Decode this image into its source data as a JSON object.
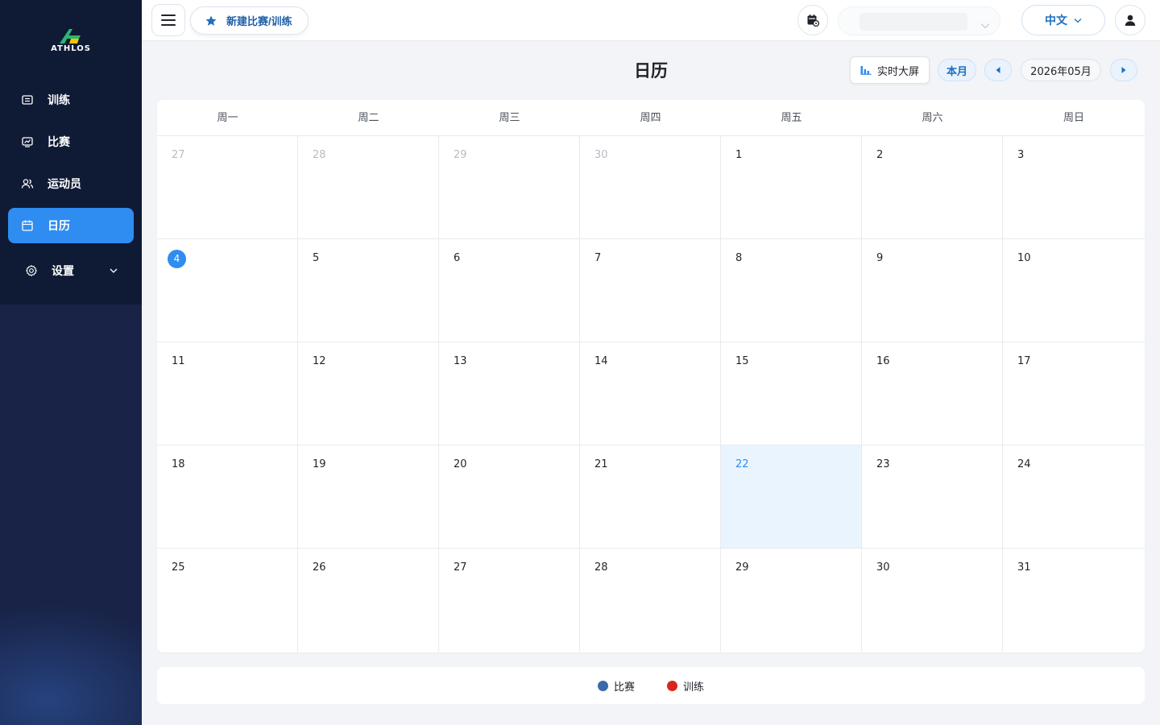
{
  "brand": {
    "logo_text": "ATHLOS"
  },
  "colors": {
    "accent": "#2f8cf0",
    "sidebar": "#182347",
    "match": "#3a6aa8",
    "training": "#d9261c"
  },
  "sidebar": {
    "items": [
      {
        "label": "训练",
        "icon": "training-icon"
      },
      {
        "label": "比赛",
        "icon": "match-icon"
      },
      {
        "label": "运动员",
        "icon": "athletes-icon"
      },
      {
        "label": "日历",
        "icon": "calendar-icon",
        "active": true
      },
      {
        "label": "设置",
        "icon": "gear-icon"
      }
    ]
  },
  "topbar": {
    "new_button": "新建比赛/训练",
    "language": "中文"
  },
  "calendar": {
    "title": "日历",
    "live_button": "实时大屏",
    "this_month_button": "本月",
    "current_month": "2026年05月",
    "weekdays": [
      "周一",
      "周二",
      "周三",
      "周四",
      "周五",
      "周六",
      "周日"
    ],
    "weeks": [
      [
        "27",
        "28",
        "29",
        "30",
        "1",
        "2",
        "3"
      ],
      [
        "4",
        "5",
        "6",
        "7",
        "8",
        "9",
        "10"
      ],
      [
        "11",
        "12",
        "13",
        "14",
        "15",
        "16",
        "17"
      ],
      [
        "18",
        "19",
        "20",
        "21",
        "22",
        "23",
        "24"
      ],
      [
        "25",
        "26",
        "27",
        "28",
        "29",
        "30",
        "31"
      ]
    ]
  },
  "legend": {
    "items": [
      {
        "label": "比赛",
        "color": "#3a6aa8"
      },
      {
        "label": "训练",
        "color": "#d9261c"
      }
    ]
  }
}
